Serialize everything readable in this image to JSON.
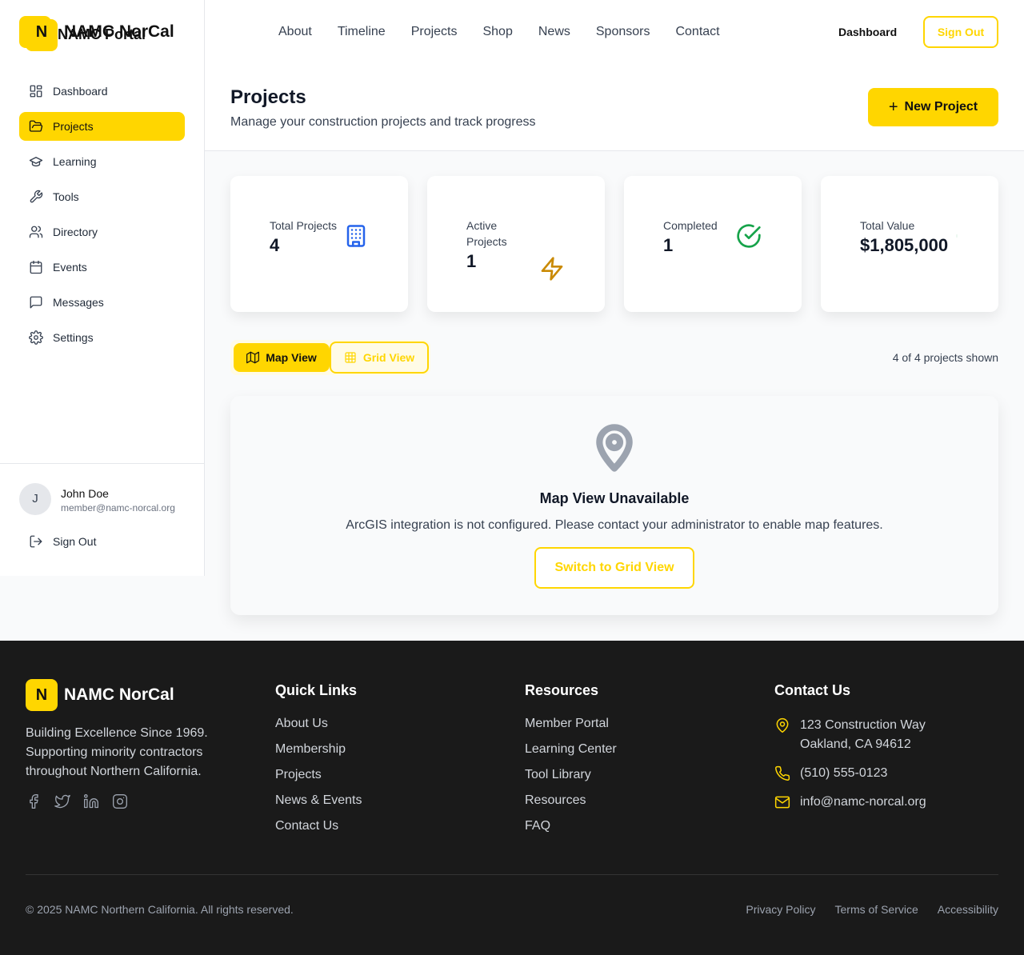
{
  "brand": {
    "name": "NAMC NorCal",
    "portal": "NAMC Portal",
    "initial": "N",
    "accent": "#ffd600"
  },
  "sidebar": {
    "items": [
      {
        "label": "Dashboard",
        "icon": "dashboard-grid-icon",
        "active": false
      },
      {
        "label": "Projects",
        "icon": "folder-open-icon",
        "active": true
      },
      {
        "label": "Learning",
        "icon": "graduation-cap-icon",
        "active": false
      },
      {
        "label": "Tools",
        "icon": "wrench-icon",
        "active": false
      },
      {
        "label": "Directory",
        "icon": "users-icon",
        "active": false
      },
      {
        "label": "Events",
        "icon": "calendar-icon",
        "active": false
      },
      {
        "label": "Messages",
        "icon": "message-square-icon",
        "active": false
      },
      {
        "label": "Settings",
        "icon": "gear-icon",
        "active": false
      }
    ],
    "user": {
      "initial": "J",
      "name": "John Doe",
      "email": "member@namc-norcal.org"
    },
    "sign_out": "Sign Out"
  },
  "topnav": {
    "links": [
      "About",
      "Timeline",
      "Projects",
      "Shop",
      "News",
      "Sponsors",
      "Contact"
    ],
    "dashboard": "Dashboard",
    "sign_out": "Sign Out"
  },
  "header": {
    "title": "Projects",
    "subtitle": "Manage your construction projects and track progress",
    "new_button": "New Project"
  },
  "stats": [
    {
      "label": "Total Projects",
      "value": "4",
      "icon": "building-icon",
      "color": "#2563eb"
    },
    {
      "label": "Active Projects",
      "value": "1",
      "icon": "lightning-icon",
      "color": "#ca8a04"
    },
    {
      "label": "Completed",
      "value": "1",
      "icon": "check-circle-icon",
      "color": "#16a34a"
    },
    {
      "label": "Total Value",
      "value": "$1,805,000",
      "icon": "dollar-icon",
      "color": "#16a34a"
    }
  ],
  "view_toggle": {
    "map": "Map View",
    "grid": "Grid View",
    "selected": "Map View"
  },
  "count_text": "4 of 4 projects shown",
  "map_card": {
    "title": "Map View Unavailable",
    "description": "ArcGIS integration is not configured. Please contact your administrator to enable map features.",
    "button": "Switch to Grid View"
  },
  "footer": {
    "brand": "NAMC NorCal",
    "tagline": "Building Excellence Since 1969. Supporting minority contractors throughout Northern California.",
    "quick_links": {
      "title": "Quick Links",
      "items": [
        "About Us",
        "Membership",
        "Projects",
        "News & Events",
        "Contact Us"
      ]
    },
    "resources": {
      "title": "Resources",
      "items": [
        "Member Portal",
        "Learning Center",
        "Tool Library",
        "Resources",
        "FAQ"
      ]
    },
    "contact": {
      "title": "Contact Us",
      "address_line1": "123 Construction Way",
      "address_line2": "Oakland, CA 94612",
      "phone": "(510) 555-0123",
      "email": "info@namc-norcal.org"
    },
    "copyright": "© 2025 NAMC Northern California. All rights reserved.",
    "legal": [
      "Privacy Policy",
      "Terms of Service",
      "Accessibility"
    ]
  }
}
